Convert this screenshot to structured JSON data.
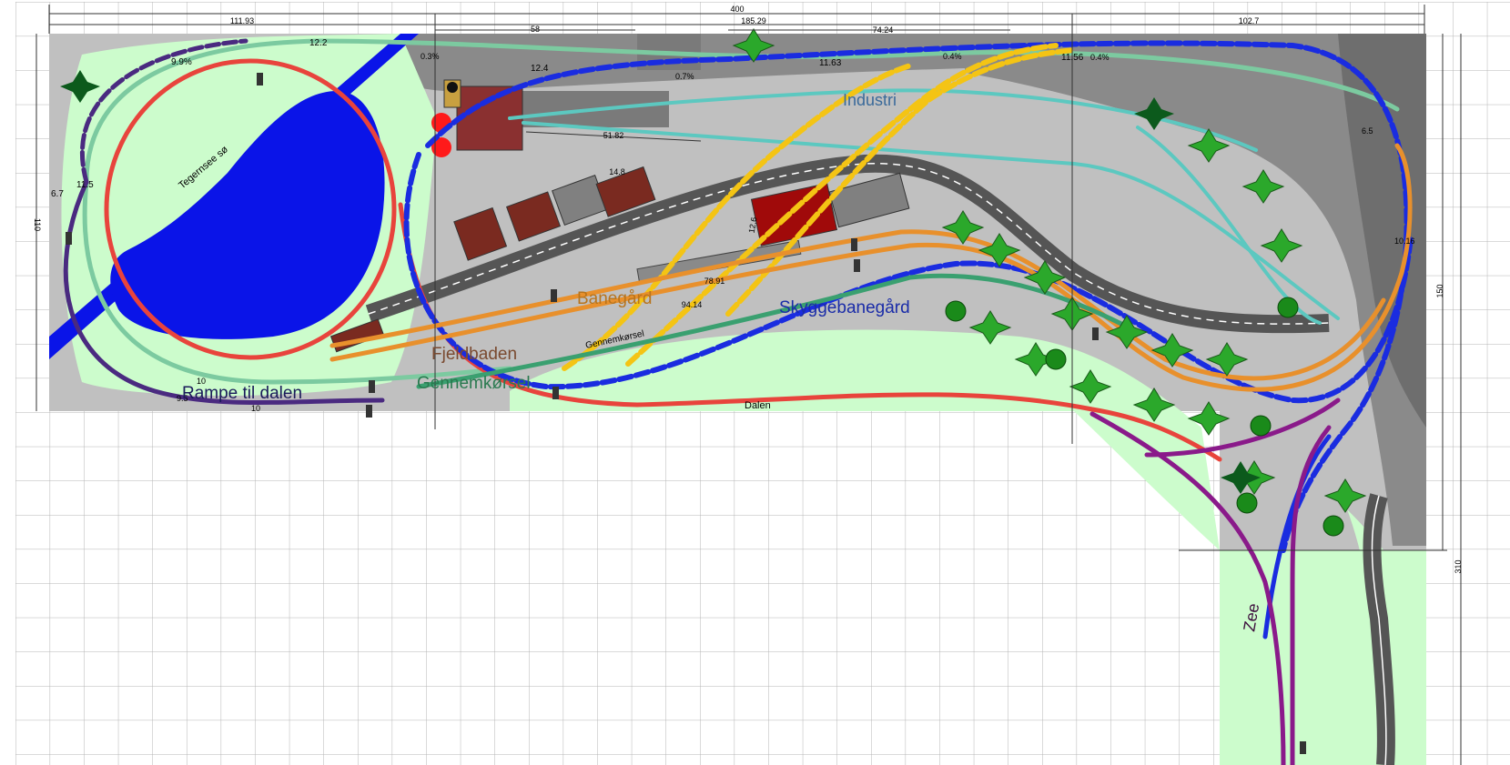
{
  "colors": {
    "board_gray": "#c0c0c0",
    "dark_gray": "#7a7a7a",
    "light_green": "#ccfccc",
    "water": "#0a14e8",
    "red_track": "#e8443c",
    "blue_track": "#1a2ce0",
    "teal_track": "#5cc8c0",
    "mint_track": "#7ccaa0",
    "yellow_track": "#f4c414",
    "orange_track": "#e8902c",
    "green_track": "#3aa070",
    "purple_track": "#8a1a8a",
    "violet_track": "#4a2a80",
    "road": "#555555",
    "building": "#7a2a20"
  },
  "labels": {
    "industri": "Industri",
    "banegaard": "Banegård",
    "skyggebanegaard": "Skyggebanegård",
    "fjeldbaden": "Fjeldbaden",
    "gennemkorsel_big": "Gennemkørsel",
    "gennemkorsel_small": "Gennemkørsel",
    "rampe": "Rampe til dalen",
    "tegernsee": "Tegernsee sø",
    "dalen": "Dalen",
    "zee": "Zee"
  },
  "dimensions": {
    "total_width": "400",
    "w_left": "111.93",
    "w_58": "58",
    "w_185": "185.29",
    "w_74": "74.24",
    "w_right": "102.7",
    "height_left": "110",
    "height_right": "150",
    "height_total": "310",
    "len_5182": "51.82",
    "len_148": "14.8",
    "len_126": "12.6",
    "len_7891": "78.91",
    "len_9414": "94.14"
  },
  "grades": {
    "g_122": "12.2",
    "g_99": "9.9%",
    "g_124": "12.4",
    "g_03": "0.3%",
    "g_07": "0.7%",
    "g_1163": "11.63",
    "g_04a": "0.4%",
    "g_1156": "11.56",
    "g_04b": "0.4%",
    "g_115": "11.5",
    "g_67": "6.7",
    "g_10a": "10",
    "g_95": "9.5",
    "g_10b": "10",
    "g_65": "6.5",
    "g_1016": "10.16"
  }
}
